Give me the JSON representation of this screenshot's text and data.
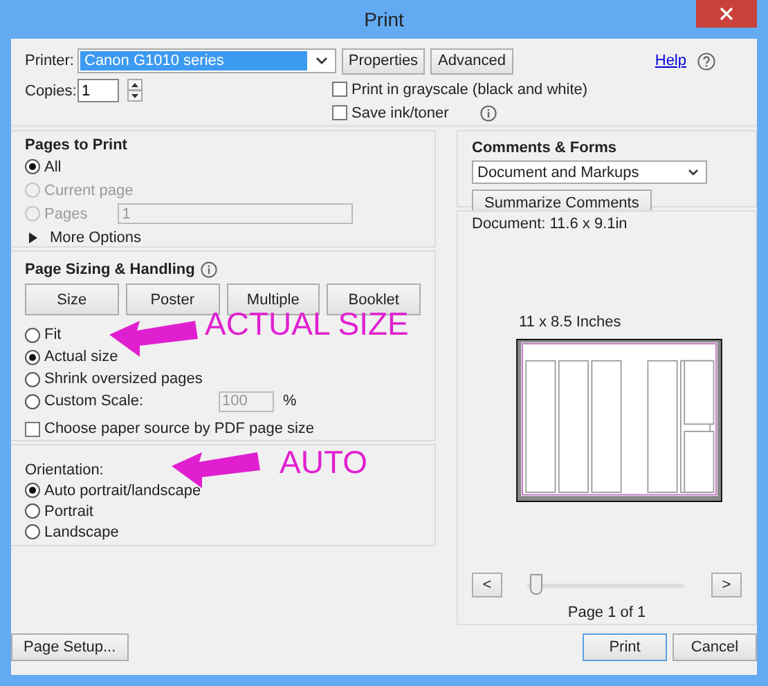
{
  "window": {
    "title": "Print"
  },
  "printer": {
    "label": "Printer:",
    "value": "Canon G1010 series",
    "buttons": [
      "Properties",
      "Advanced"
    ]
  },
  "help": {
    "label": "Help"
  },
  "copies": {
    "label": "Copies:",
    "value": "1"
  },
  "options": [
    {
      "label": "Print in grayscale (black and white)",
      "checked": false,
      "info": false
    },
    {
      "label": "Save ink/toner",
      "checked": false,
      "info": true
    }
  ],
  "pages_to_print": {
    "title": "Pages to Print",
    "options": [
      {
        "label": "All",
        "selected": true,
        "disabled": false
      },
      {
        "label": "Current page",
        "selected": false,
        "disabled": true
      },
      {
        "label": "Pages",
        "selected": false,
        "disabled": true,
        "value": "1"
      }
    ],
    "more": "More Options"
  },
  "page_sizing": {
    "title": "Page Sizing & Handling",
    "buttons": [
      "Size",
      "Poster",
      "Multiple",
      "Booklet"
    ],
    "options": [
      {
        "label": "Fit",
        "selected": false
      },
      {
        "label": "Actual size",
        "selected": true
      },
      {
        "label": "Shrink oversized pages",
        "selected": false
      },
      {
        "label": "Custom Scale:",
        "selected": false,
        "value": "100",
        "unit": "%"
      }
    ],
    "checkbox": {
      "label": "Choose paper source by PDF page size",
      "checked": false
    }
  },
  "orientation": {
    "title": "Orientation:",
    "options": [
      {
        "label": "Auto portrait/landscape",
        "selected": true
      },
      {
        "label": "Portrait",
        "selected": false
      },
      {
        "label": "Landscape",
        "selected": false
      }
    ]
  },
  "comments_forms": {
    "title": "Comments & Forms",
    "value": "Document and Markups",
    "button": "Summarize Comments"
  },
  "preview": {
    "document": "Document: 11.6 x 9.1in",
    "paper": "11 x 8.5 Inches",
    "prev": "<",
    "next": ">",
    "level": 0,
    "page": "Page 1 of 1"
  },
  "footer": {
    "page_setup": "Page Setup...",
    "print": "Print",
    "cancel": "Cancel"
  },
  "annotations": [
    {
      "text": "ACTUAL SIZE"
    },
    {
      "text": "AUTO"
    }
  ]
}
